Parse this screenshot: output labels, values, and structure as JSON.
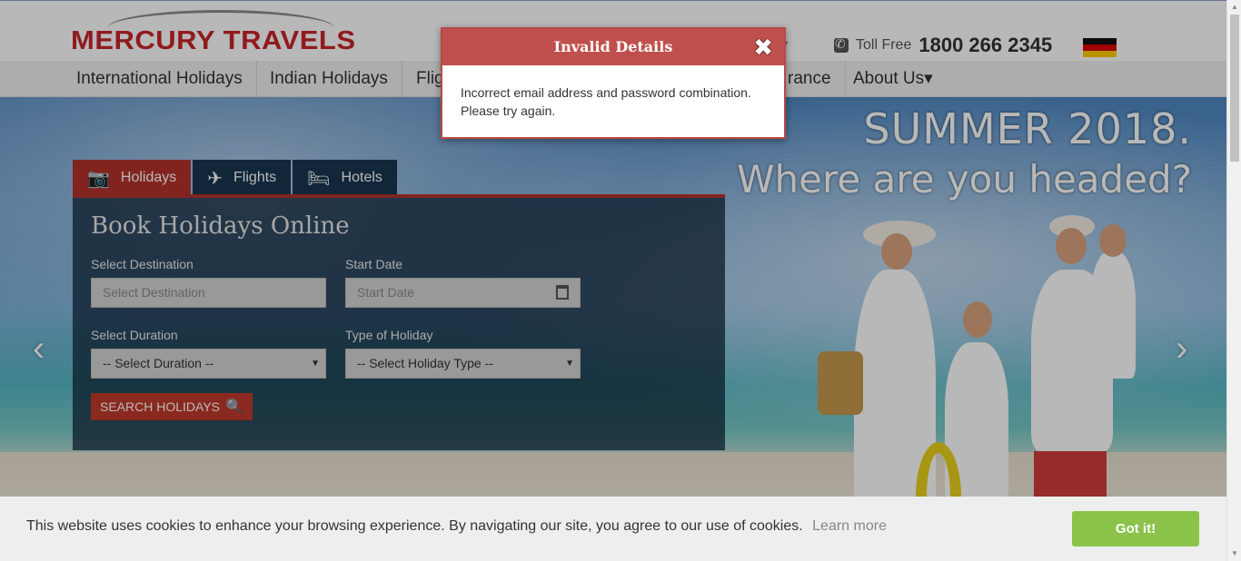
{
  "header": {
    "logo_text": "MERCURY TRAVELS",
    "tollfree_label": "Toll Free",
    "tollfree_number": "1800 266 2345",
    "flag": "germany-flag"
  },
  "nav": {
    "items": [
      {
        "label": "International Holidays"
      },
      {
        "label": "Indian Holidays"
      },
      {
        "label": "Flig"
      },
      {
        "label": "rance"
      },
      {
        "label": "About Us▾"
      }
    ]
  },
  "hero": {
    "headline1": "SUMMER 2018.",
    "headline2": "Where are you headed?"
  },
  "booking": {
    "tabs": [
      {
        "label": "Holidays",
        "icon": "camera-icon"
      },
      {
        "label": "Flights",
        "icon": "plane-icon"
      },
      {
        "label": "Hotels",
        "icon": "bed-icon"
      }
    ],
    "title": "Book Holidays Online",
    "destination_label": "Select Destination",
    "destination_placeholder": "Select Destination",
    "start_date_label": "Start Date",
    "start_date_placeholder": "Start Date",
    "duration_label": "Select Duration",
    "duration_value": "-- Select Duration --",
    "holiday_type_label": "Type of Holiday",
    "holiday_type_value": "-- Select Holiday Type --",
    "search_button": "SEARCH HOLIDAYS"
  },
  "modal": {
    "title": "Invalid Details",
    "close": "✖",
    "message": "Incorrect email address and password combination. Please try again."
  },
  "cookie": {
    "text": "This website uses cookies to enhance your browsing experience. By navigating our site, you agree to our use of cookies.",
    "link": "Learn more",
    "button": "Got it!"
  },
  "colors": {
    "brand_red": "#c8242a",
    "tab_active": "#b3332b",
    "cookie_button": "#8bc34a",
    "modal_header": "#c0504d"
  }
}
